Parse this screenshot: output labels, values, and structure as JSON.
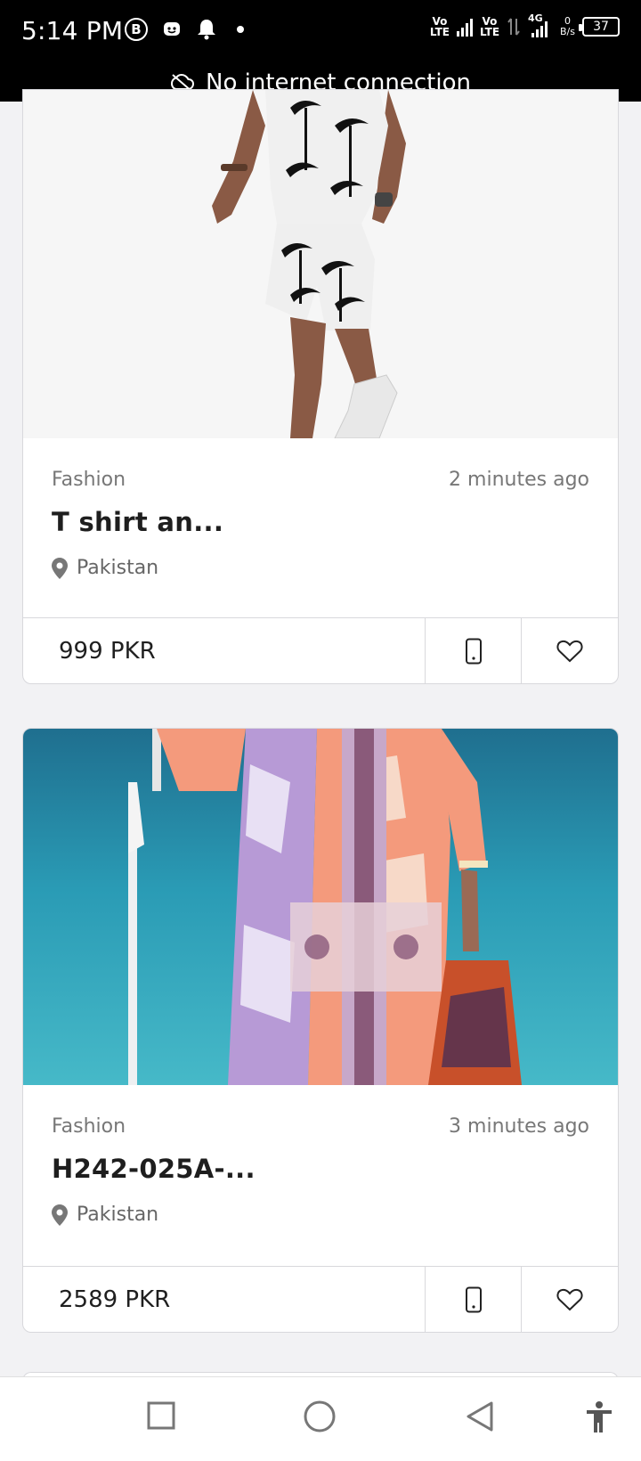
{
  "status_bar": {
    "time": "5:14 PM",
    "badge_letter": "B",
    "volte1": "Vo\nLTE",
    "volte2": "Vo\nLTE",
    "network": "4G",
    "speed_value": "0",
    "speed_unit": "B/s",
    "battery": "37"
  },
  "offline_banner": {
    "text": "No internet connection",
    "icon": "cloud-off-icon"
  },
  "listings": [
    {
      "category": "Fashion",
      "time": "2 minutes ago",
      "title": "T shirt an...",
      "location": "Pakistan",
      "price": "999 PKR"
    },
    {
      "category": "Fashion",
      "time": "3 minutes ago",
      "title": "H242-025A-...",
      "location": "Pakistan",
      "price": "2589 PKR"
    }
  ],
  "nav": {
    "icons": [
      "square-icon",
      "circle-icon",
      "back-triangle-icon",
      "accessibility-icon"
    ]
  }
}
